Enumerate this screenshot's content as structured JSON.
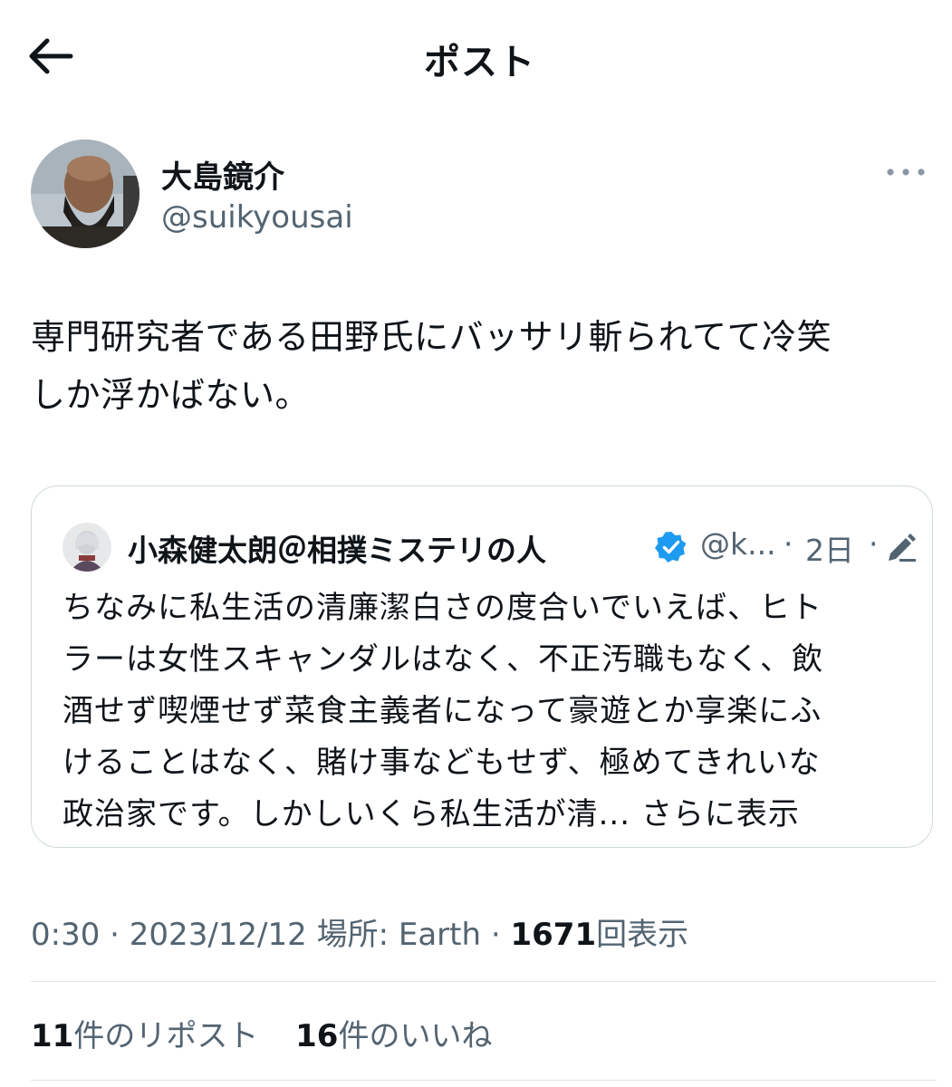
{
  "header": {
    "title": "ポスト",
    "back_icon": "arrow-left-icon"
  },
  "author": {
    "name": "大島鏡介",
    "handle": "@suikyousai",
    "more_icon": "more-horizontal-icon"
  },
  "post": {
    "text": "専門研究者である田野氏にバッサリ斬られてて冷笑\nしか浮かばない。"
  },
  "quote": {
    "name": "小森健太朗＠相撲ミステリの人",
    "verified_icon": "verified-badge-icon",
    "verified_color": "#1d9bf0",
    "handle": "@k...",
    "separator": "·",
    "time": "2日",
    "edit_icon": "edited-pencil-icon",
    "text": "ちなみに私生活の清廉潔白さの度合いでいえば、ヒト\nラーは女性スキャンダルはなく、不正汚職もなく、飲\n酒せず喫煙せず菜食主義者になって豪遊とか享楽にふ\nけることはなく、賭け事などもせず、極めてきれいな\n政治家です。しかしいくら私生活が清...",
    "show_more": "さらに表示"
  },
  "meta": {
    "time": "0:30",
    "separator": "·",
    "date": "2023/12/12",
    "location": "場所: Earth",
    "views_count": "1671",
    "views_label": "回表示"
  },
  "stats": {
    "reposts_count": "11",
    "reposts_label": "件のリポスト",
    "likes_count": "16",
    "likes_label": "件のいいね"
  }
}
